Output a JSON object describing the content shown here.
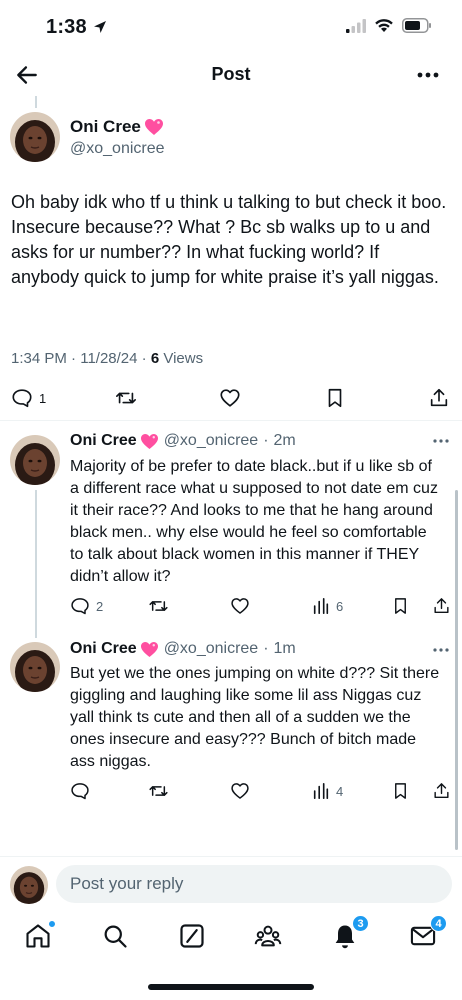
{
  "status_bar": {
    "time": "1:38"
  },
  "nav": {
    "title": "Post"
  },
  "main_post": {
    "author_name": "Oni Cree",
    "author_handle": "@xo_onicree",
    "text": "Oh baby idk who tf u think u talking to but check it boo. Insecure because?? What ? Bc sb walks up to u and asks for ur number?? In what fucking world? If anybody quick to jump for white praise it’s yall niggas.",
    "time": "1:34 PM",
    "date": "11/28/24",
    "views_count": "6",
    "views_label": "Views",
    "reply_count": "1"
  },
  "replies": [
    {
      "author_name": "Oni Cree",
      "author_handle": "@xo_onicree",
      "separator": "·",
      "age": "2m",
      "text": "Majority of be prefer to date black..but if u like sb of a different race what u supposed to not date em cuz it their race?? And looks to me that he hang around black men.. why else would he feel so comfortable to talk about black women in this manner if THEY didn’t allow it?",
      "reply_count": "2",
      "views": "6"
    },
    {
      "author_name": "Oni Cree",
      "author_handle": "@xo_onicree",
      "separator": "·",
      "age": "1m",
      "text": "But yet we the ones jumping on white d??? Sit there giggling and laughing like some lil ass Niggas cuz yall think ts cute and then all of a sudden we the ones insecure and easy??? Bunch of bitch made ass niggas.",
      "views": "4"
    }
  ],
  "composer": {
    "placeholder": "Post your reply"
  },
  "tabbar": {
    "notifications_badge": "3",
    "messages_badge": "4"
  },
  "colors": {
    "accent": "#1d9bf0",
    "icon": "#536471",
    "heart_emoji": "#ff4fa0"
  }
}
